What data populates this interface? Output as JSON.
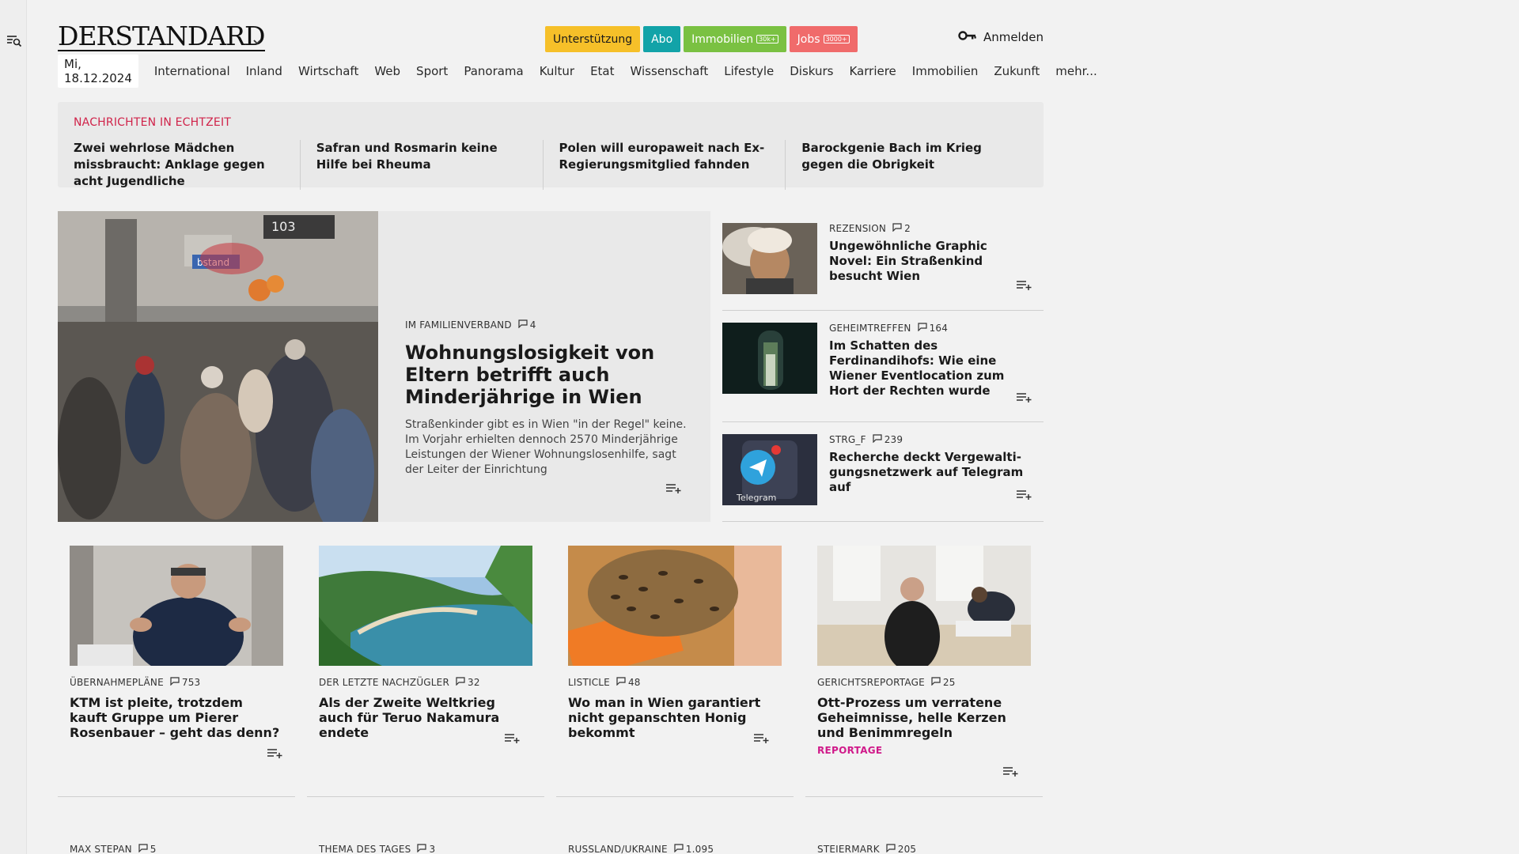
{
  "sidebar": {
    "menu_icon": "menu-search-icon"
  },
  "header": {
    "logo_text": "DERSTANDARD",
    "links": [
      {
        "label": "Unterstützung",
        "bg": "#f6c029",
        "color": "#1a1a1a",
        "sub": ""
      },
      {
        "label": "Abo",
        "bg": "#12a3a8",
        "color": "#ffffff",
        "sub": ""
      },
      {
        "label": "Immobilien",
        "bg": "#7ac142",
        "color": "#ffffff",
        "sub": "30k+"
      },
      {
        "label": "Jobs",
        "bg": "#f06b6b",
        "color": "#ffffff",
        "sub": "3000+"
      }
    ],
    "login_label": "Anmelden"
  },
  "nav": {
    "date": "Mi, 18.12.2024",
    "items": [
      "International",
      "Inland",
      "Wirtschaft",
      "Web",
      "Sport",
      "Panorama",
      "Kultur",
      "Etat",
      "Wissenschaft",
      "Lifestyle",
      "Diskurs",
      "Karriere",
      "Immobilien",
      "Zukunft",
      "mehr..."
    ]
  },
  "realtime": {
    "label": "NACHRICHTEN IN ECHTZEIT",
    "items": [
      "Zwei wehrlose Mädchen missbraucht: Anklage gegen acht Jugendliche",
      "Safran und Rosmarin keine Hilfe bei Rheuma",
      "Polen will europaweit nach Ex-Regie­rungsmitglied fahnden",
      "Barockgenie Bach im Krieg gegen die Obrigkeit"
    ]
  },
  "hero": {
    "kicker": "Im Familienverband",
    "comments": "4",
    "title": "Wohnungslosigkeit von Eltern betrifft auch Minderjährige in Wien",
    "teaser": "Straßenkinder gibt es in Wien \"in der Regel\" keine. Im Vorjahr erhielten dennoch 2570 Minderjährige Leistungen der Wiener Wohnungslosenhilfe, sagt der Leiter der Einrichtung"
  },
  "side": [
    {
      "kicker": "Rezension",
      "comments": "2",
      "title": "Ungewöhnliche Graphic Novel: Ein Straßenkind besucht Wien"
    },
    {
      "kicker": "Geheimtreffen",
      "comments": "164",
      "title": "Im Schatten des Ferdinandihofs: Wie eine Wiener Eventlocation zum Hort der Rechten wurde"
    },
    {
      "kicker": "STRG_F",
      "comments": "239",
      "title": "Recherche deckt Vergewalti­gungsnetzwerk auf Telegram auf",
      "img_label": "Telegram"
    }
  ],
  "cards": [
    {
      "kicker": "Übernahmepläne",
      "comments": "753",
      "title": "KTM ist pleite, trotzdem kauft Gruppe um Pierer Rosenbauer – geht das denn?",
      "tag": ""
    },
    {
      "kicker": "Der letzte Nachzügler",
      "comments": "32",
      "title": "Als der Zweite Weltkrieg auch für Teruo Nakamura endete",
      "tag": ""
    },
    {
      "kicker": "Listicle",
      "comments": "48",
      "title": "Wo man in Wien garantiert nicht gepanschten Honig bekommt",
      "tag": ""
    },
    {
      "kicker": "Gerichtsreportage",
      "comments": "25",
      "title": "Ott-Prozess um verratene Geheimnisse, helle Kerzen und Benimmregeln",
      "tag": "REPORTAGE"
    }
  ],
  "bottom": [
    {
      "kicker": "Max Stepan",
      "comments": "5"
    },
    {
      "kicker": "Thema des Tages",
      "comments": "3"
    },
    {
      "kicker": "Russland/Ukraine",
      "comments": "1.095"
    },
    {
      "kicker": "Steiermark",
      "comments": "205"
    }
  ]
}
